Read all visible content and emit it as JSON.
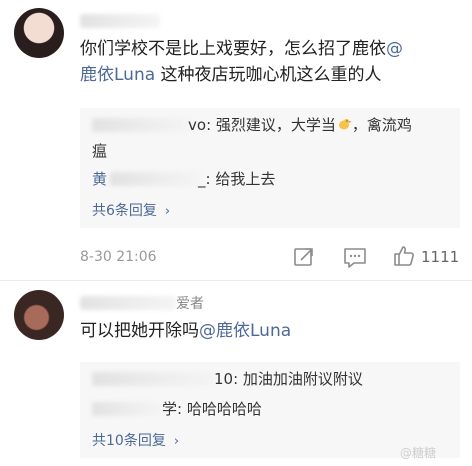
{
  "comments": [
    {
      "text": "你们学校不是比上戏要好，怎么招了鹿依",
      "mention_1": "@",
      "mention_2": "鹿依Luna",
      "text_2": " 这种夜店玩咖心机这么重的人",
      "replies": [
        {
          "name_tail": "vo",
          "text": ": 强烈建议，大学当",
          "icon": "chick-emoji",
          "text_after": "，禽流鸡"
        },
        {
          "name_tail": "",
          "text": "瘟",
          "icon": "",
          "text_after": ""
        },
        {
          "name_head": "黄",
          "name_tail": "_",
          "text": ": 给我上去"
        }
      ],
      "more_label": "共6条回复",
      "time": "8-30 21:06",
      "like_count": "1111"
    },
    {
      "name_suffix": "爱者",
      "text": "可以把她开除吗",
      "mention": "@鹿依Luna",
      "replies": [
        {
          "name_tail": "10",
          "text": ": 加油加油附议附议"
        },
        {
          "name_tail": "学",
          "text": ": 哈哈哈哈哈"
        }
      ],
      "more_label": "共10条回复"
    }
  ],
  "watermark": "@糖糖"
}
